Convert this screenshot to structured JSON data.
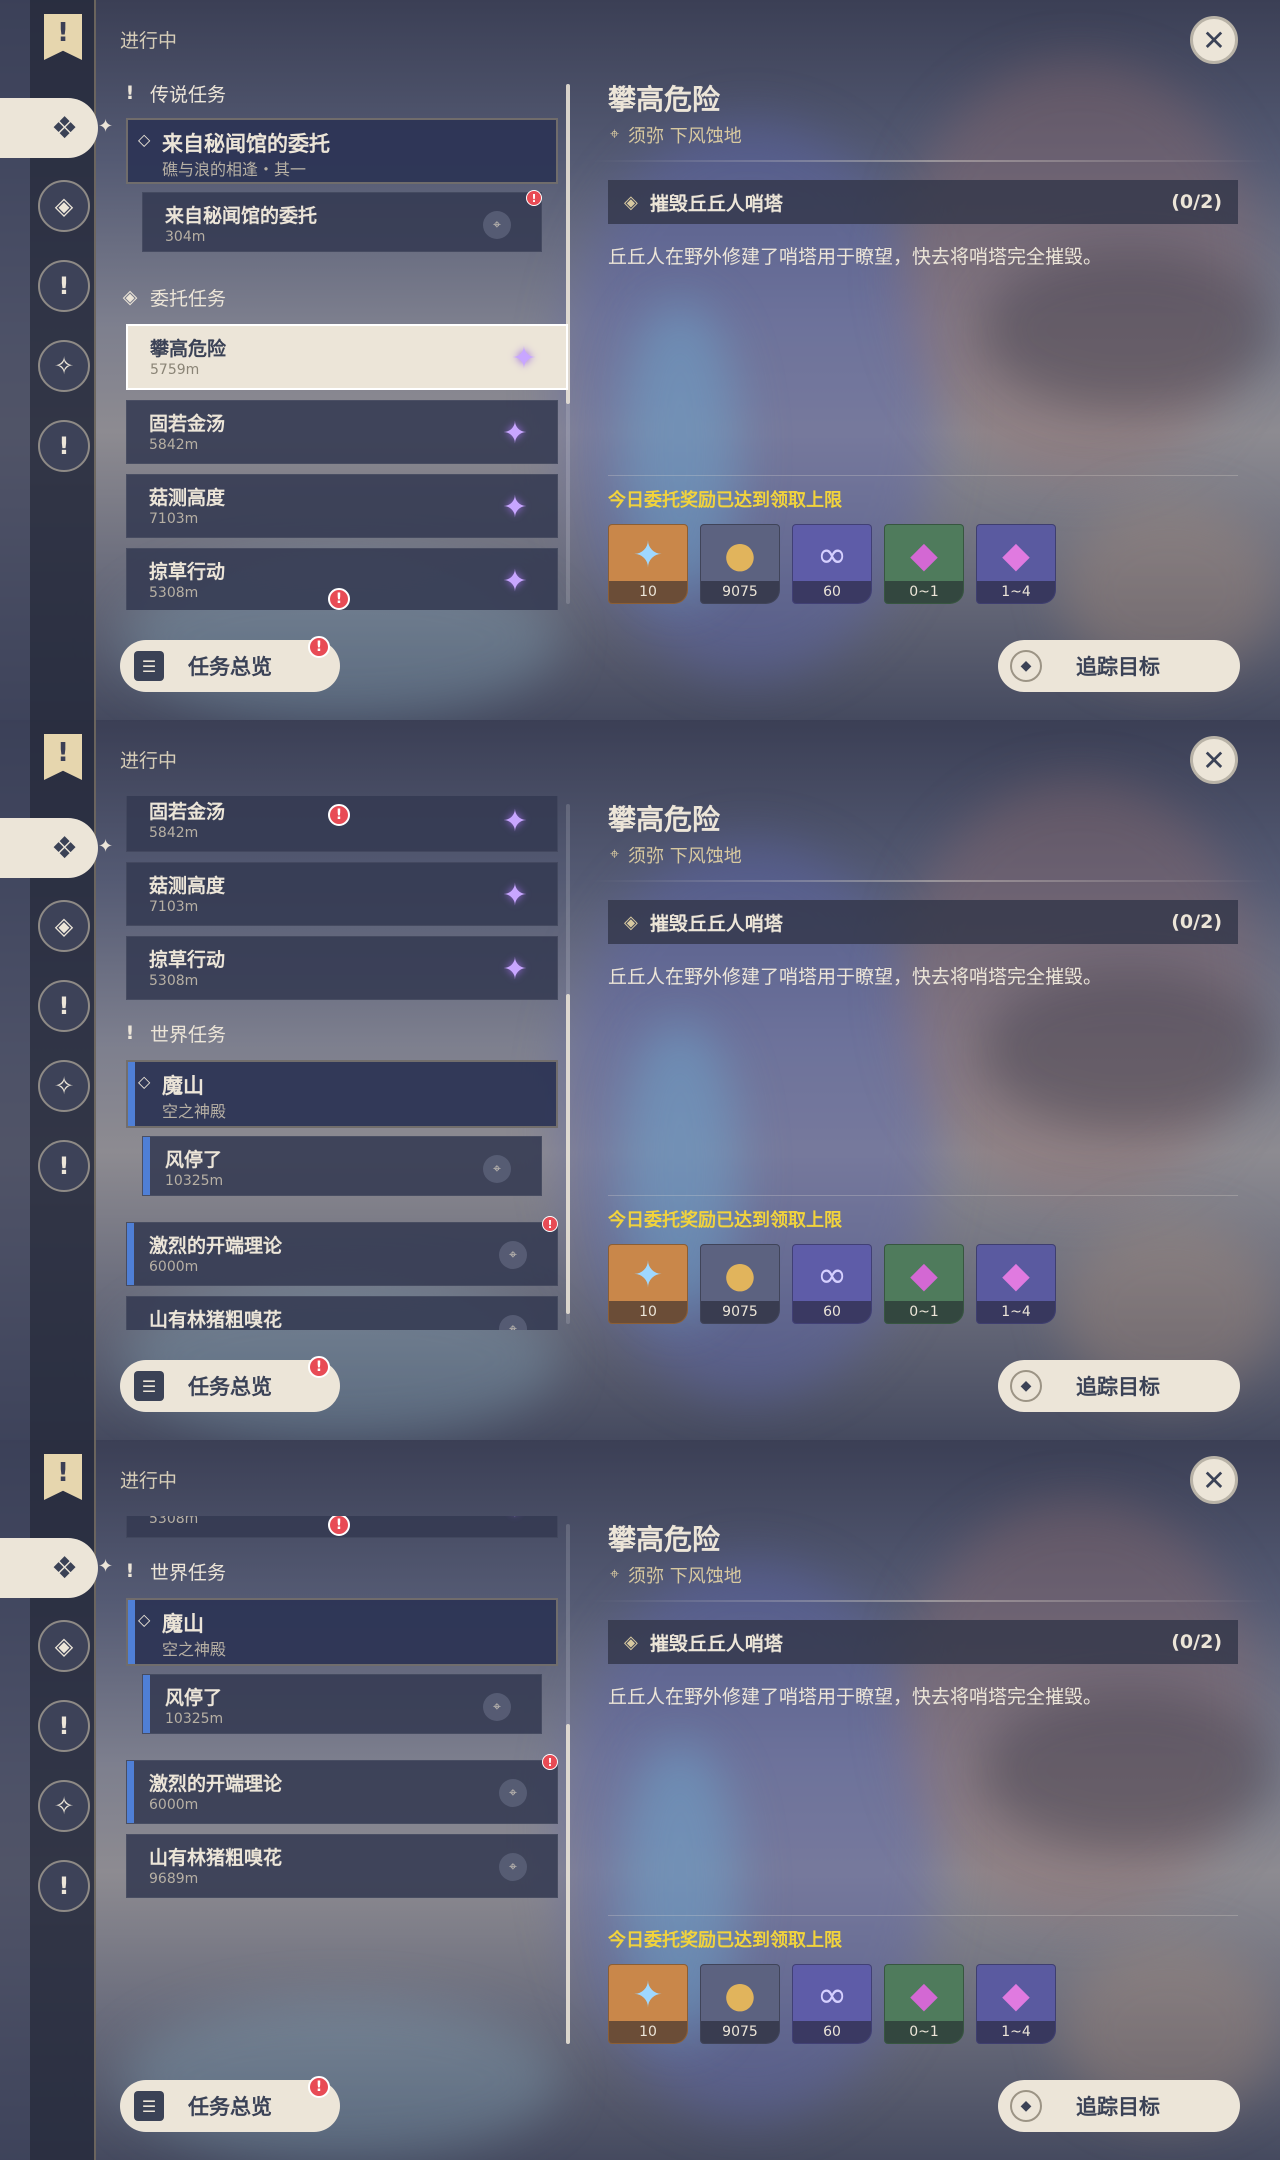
{
  "status": "进行中",
  "icons": {
    "close": "close-icon",
    "flag": "quest-flag-icon",
    "diamond": "diamond-icon",
    "pin": "map-pin-icon",
    "star": "purple-star-icon",
    "alert": "exclamation-icon"
  },
  "colors": {
    "accent": "#ece5d8",
    "panel": "#343a52",
    "reward_note": "#f2d33c",
    "alert": "#e84b55",
    "wq_bar": "#4f7fd6"
  },
  "detail": {
    "title": "攀高危险",
    "location": "须弥  下风蚀地",
    "objective": "摧毁丘丘人哨塔",
    "objective_count": "(0/2)",
    "description": "丘丘人在野外修建了哨塔用于瞭望，快去将哨塔完全摧毁。",
    "reward_note": "今日委托奖励已达到领取上限",
    "rewards": [
      {
        "count": "10",
        "kind": "primogem",
        "color": "#c9874a"
      },
      {
        "count": "9075",
        "kind": "mora",
        "color": "#c59a5a"
      },
      {
        "count": "60",
        "kind": "friendship",
        "color": "#5e5ca8"
      },
      {
        "count": "0~1",
        "kind": "crystal-small",
        "color": "#4f7b5c"
      },
      {
        "count": "1~4",
        "kind": "crystal-large",
        "color": "#5a5aa0"
      }
    ]
  },
  "sections": {
    "legend": "传说任务",
    "commission": "委托任务",
    "world": "世界任务"
  },
  "legend_quest": {
    "title": "来自秘闻馆的委托",
    "subtitle": "礁与浪的相逢・其一",
    "step": "来自秘闻馆的委托",
    "step_dist": "304m"
  },
  "commissions": [
    {
      "name": "攀高危险",
      "dist": "5759m"
    },
    {
      "name": "固若金汤",
      "dist": "5842m"
    },
    {
      "name": "菇测高度",
      "dist": "7103m"
    },
    {
      "name": "掠草行动",
      "dist": "5308m"
    }
  ],
  "world_quest": {
    "title": "魔山",
    "subtitle": "空之神殿",
    "step": "风停了",
    "step_dist": "10325m"
  },
  "world_others": [
    {
      "name": "激烈的开端理论",
      "dist": "6000m"
    },
    {
      "name": "山有林猪粗嗅花",
      "dist": "9689m"
    }
  ],
  "buttons": {
    "overview": "任务总览",
    "track": "追踪目标"
  }
}
